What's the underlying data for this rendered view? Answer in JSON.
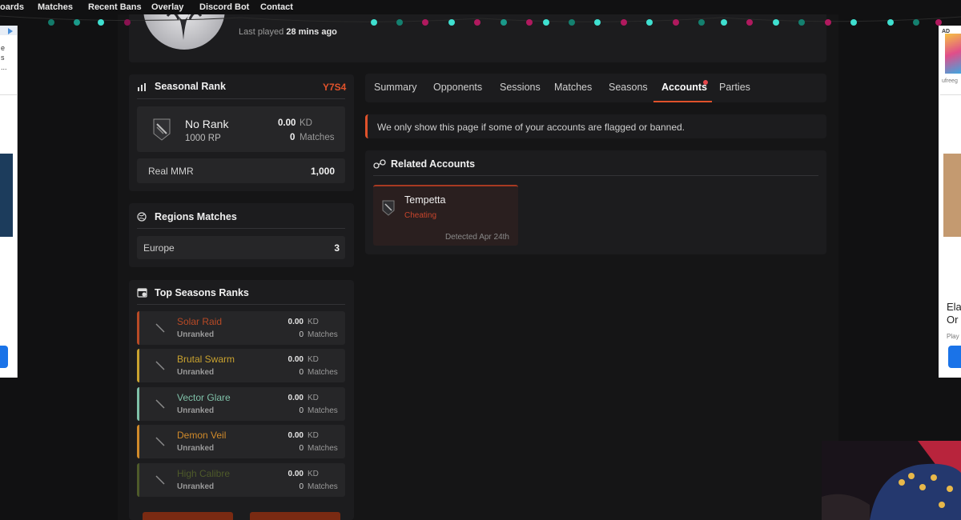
{
  "nav": {
    "items": [
      "oards",
      "Matches",
      "Recent Bans",
      "Overlay",
      "Discord Bot",
      "Contact"
    ]
  },
  "profile": {
    "last_played_label": "Last played",
    "last_played_value": "28 mins ago"
  },
  "seasonal_rank": {
    "title": "Seasonal Rank",
    "season_code": "Y7S4",
    "rank_name": "No Rank",
    "rp": "1000 RP",
    "kd_value": "0.00",
    "kd_label": "KD",
    "matches_value": "0",
    "matches_label": "Matches",
    "mmr_label": "Real MMR",
    "mmr_value": "1,000"
  },
  "regions": {
    "title": "Regions Matches",
    "rows": [
      {
        "region": "Europe",
        "count": "3"
      }
    ]
  },
  "top_seasons": {
    "title": "Top Seasons Ranks",
    "rows": [
      {
        "name": "Solar Raid",
        "rank": "Unranked",
        "kd": "0.00",
        "kd_label": "KD",
        "matches": "0",
        "matches_label": "Matches",
        "color": "#b84a26"
      },
      {
        "name": "Brutal Swarm",
        "rank": "Unranked",
        "kd": "0.00",
        "kd_label": "KD",
        "matches": "0",
        "matches_label": "Matches",
        "color": "#c9a22f"
      },
      {
        "name": "Vector Glare",
        "rank": "Unranked",
        "kd": "0.00",
        "kd_label": "KD",
        "matches": "0",
        "matches_label": "Matches",
        "color": "#7fc0a8"
      },
      {
        "name": "Demon Veil",
        "rank": "Unranked",
        "kd": "0.00",
        "kd_label": "KD",
        "matches": "0",
        "matches_label": "Matches",
        "color": "#d08a2a"
      },
      {
        "name": "High Calibre",
        "rank": "Unranked",
        "kd": "0.00",
        "kd_label": "KD",
        "matches": "0",
        "matches_label": "Matches",
        "color": "#4e5a2a"
      }
    ]
  },
  "tabs": [
    "Summary",
    "Opponents",
    "Sessions",
    "Matches",
    "Seasons",
    "Accounts",
    "Parties"
  ],
  "active_tab": "Accounts",
  "notice": "We only show this page if some of your accounts are flagged or banned.",
  "related": {
    "title": "Related Accounts",
    "accounts": [
      {
        "name": "Tempetta",
        "reason": "Cheating",
        "detected": "Detected Apr 24th"
      }
    ]
  },
  "ads": {
    "left_tag": "",
    "right_tag": "AD",
    "right_domain": "ufreeg",
    "right_text_1": "Ela",
    "right_text_2": "Or",
    "right_text_3": "Play",
    "left_text_1": "e",
    "left_text_2": "s",
    "left_text_3": "..."
  },
  "colors": {
    "accent_red": "#e0522b",
    "cheating_red": "#c8452c",
    "tab_dot": "#e5484d"
  }
}
